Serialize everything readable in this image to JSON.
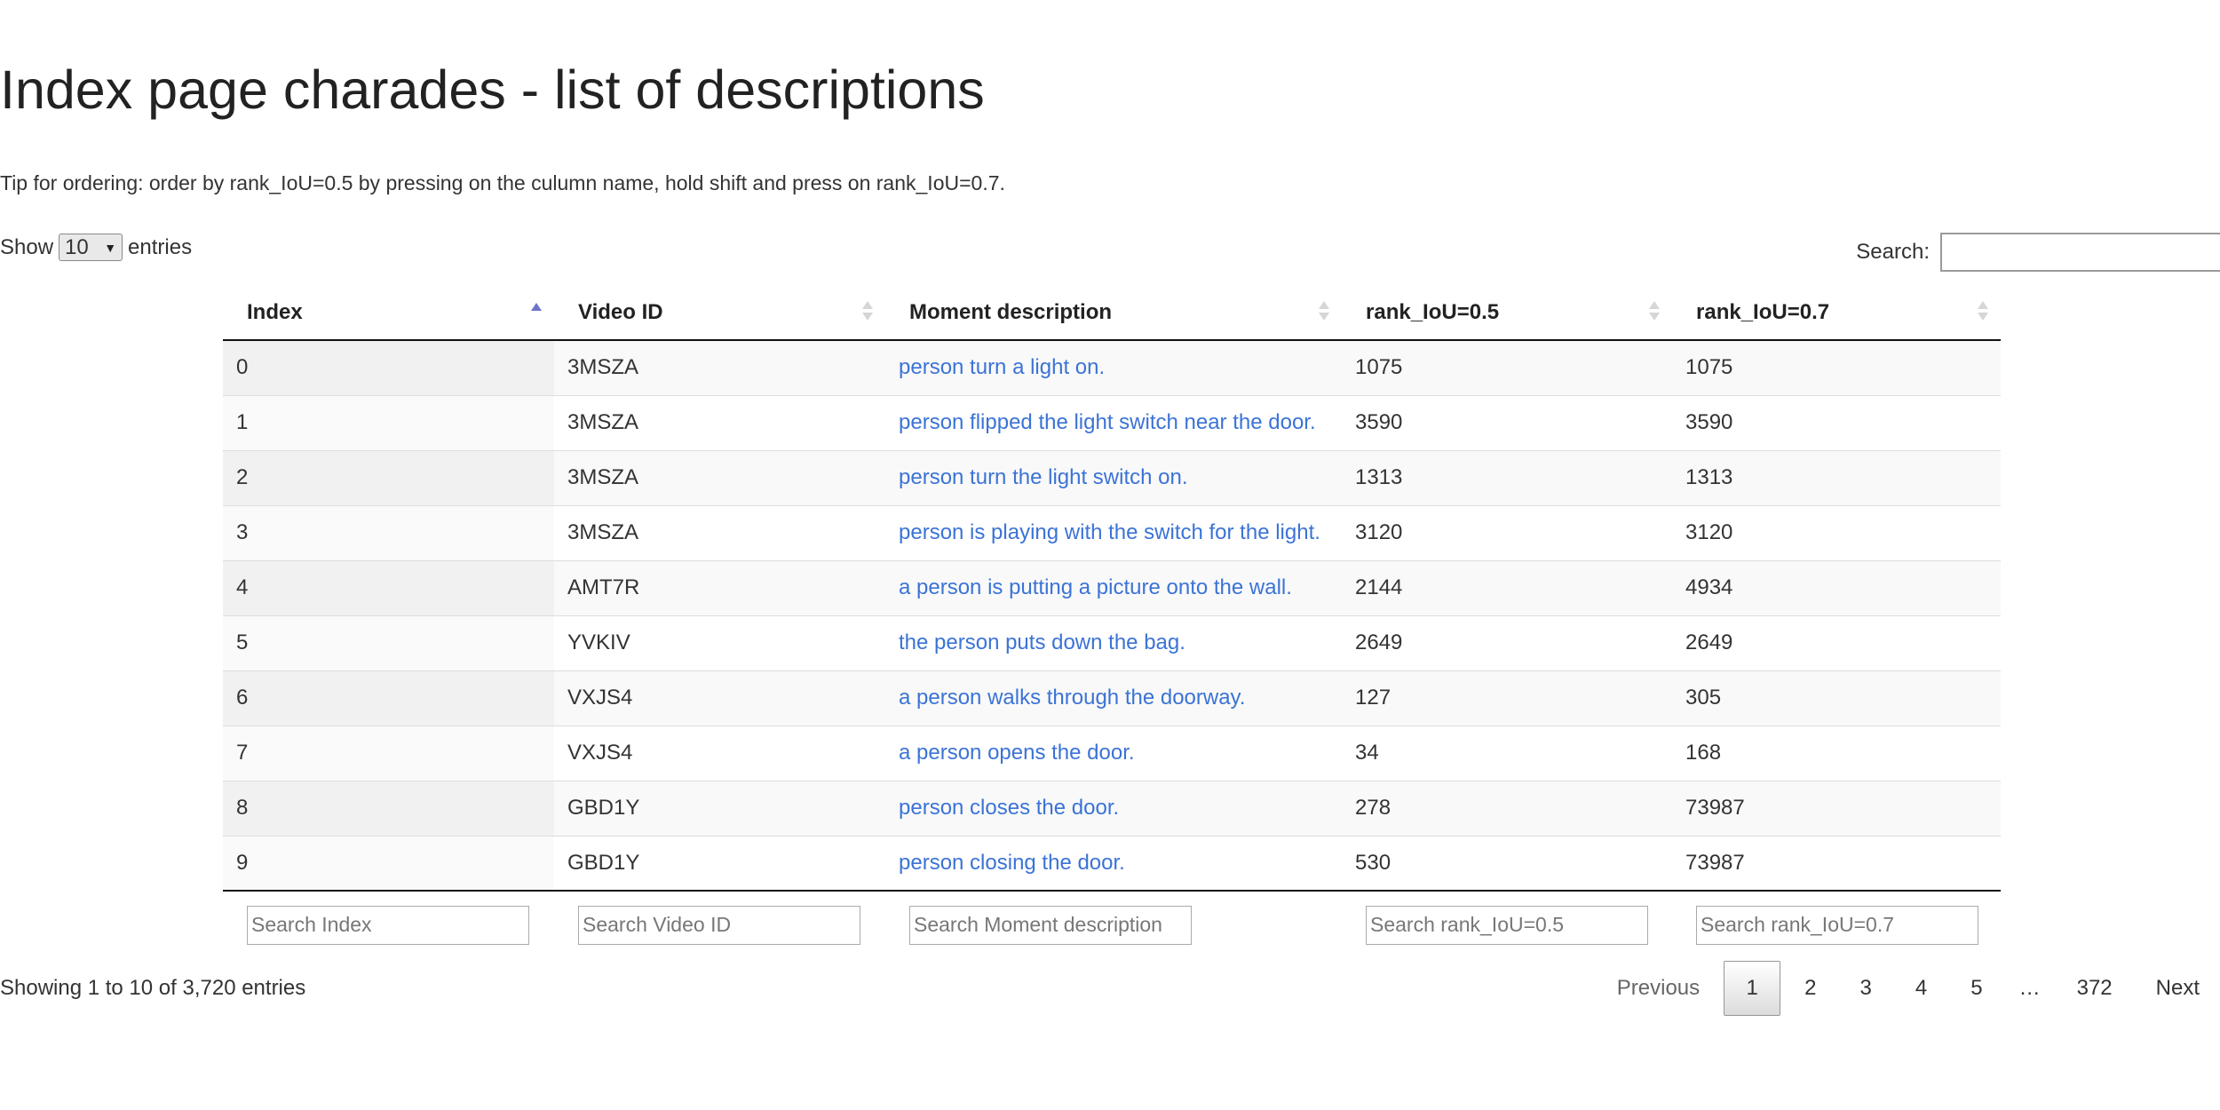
{
  "title": "Index page charades - list of descriptions",
  "tip": "Tip for ordering: order by rank_IoU=0.5 by pressing on the culumn name, hold shift and press on rank_IoU=0.7.",
  "length": {
    "show_label": "Show",
    "selected": "10",
    "entries_label": "entries"
  },
  "search": {
    "label": "Search:",
    "value": ""
  },
  "table": {
    "columns": [
      "Index",
      "Video ID",
      "Moment description",
      "rank_IoU=0.5",
      "rank_IoU=0.7"
    ],
    "sorted_column": "Index",
    "sort_direction": "ascending",
    "rows": [
      [
        "0",
        "3MSZA",
        "person turn a light on.",
        "1075",
        "1075"
      ],
      [
        "1",
        "3MSZA",
        "person flipped the light switch near the door.",
        "3590",
        "3590"
      ],
      [
        "2",
        "3MSZA",
        "person turn the light switch on.",
        "1313",
        "1313"
      ],
      [
        "3",
        "3MSZA",
        "person is playing with the switch for the light.",
        "3120",
        "3120"
      ],
      [
        "4",
        "AMT7R",
        "a person is putting a picture onto the wall.",
        "2144",
        "4934"
      ],
      [
        "5",
        "YVKIV",
        "the person puts down the bag.",
        "2649",
        "2649"
      ],
      [
        "6",
        "VXJS4",
        "a person walks through the doorway.",
        "127",
        "305"
      ],
      [
        "7",
        "VXJS4",
        "a person opens the door.",
        "34",
        "168"
      ],
      [
        "8",
        "GBD1Y",
        "person closes the door.",
        "278",
        "73987"
      ],
      [
        "9",
        "GBD1Y",
        "person closing the door.",
        "530",
        "73987"
      ]
    ],
    "footer_placeholders": [
      "Search Index",
      "Search Video ID",
      "Search Moment description",
      "Search rank_IoU=0.5",
      "Search rank_IoU=0.7"
    ]
  },
  "info": "Showing 1 to 10 of 3,720 entries",
  "pagination": {
    "previous": "Previous",
    "pages": [
      "1",
      "2",
      "3",
      "4",
      "5"
    ],
    "ellipsis": "…",
    "last": "372",
    "next": "Next",
    "current": "1"
  },
  "colors": {
    "link": "#3b73d6",
    "sort_active": "#6d74c9",
    "sort_inactive": "#d6d6d6"
  },
  "icons": {
    "sort_asc": "sort-ascending-icon",
    "sort_both": "sort-both-icon",
    "dropdown": "dropdown-arrow-icon"
  }
}
